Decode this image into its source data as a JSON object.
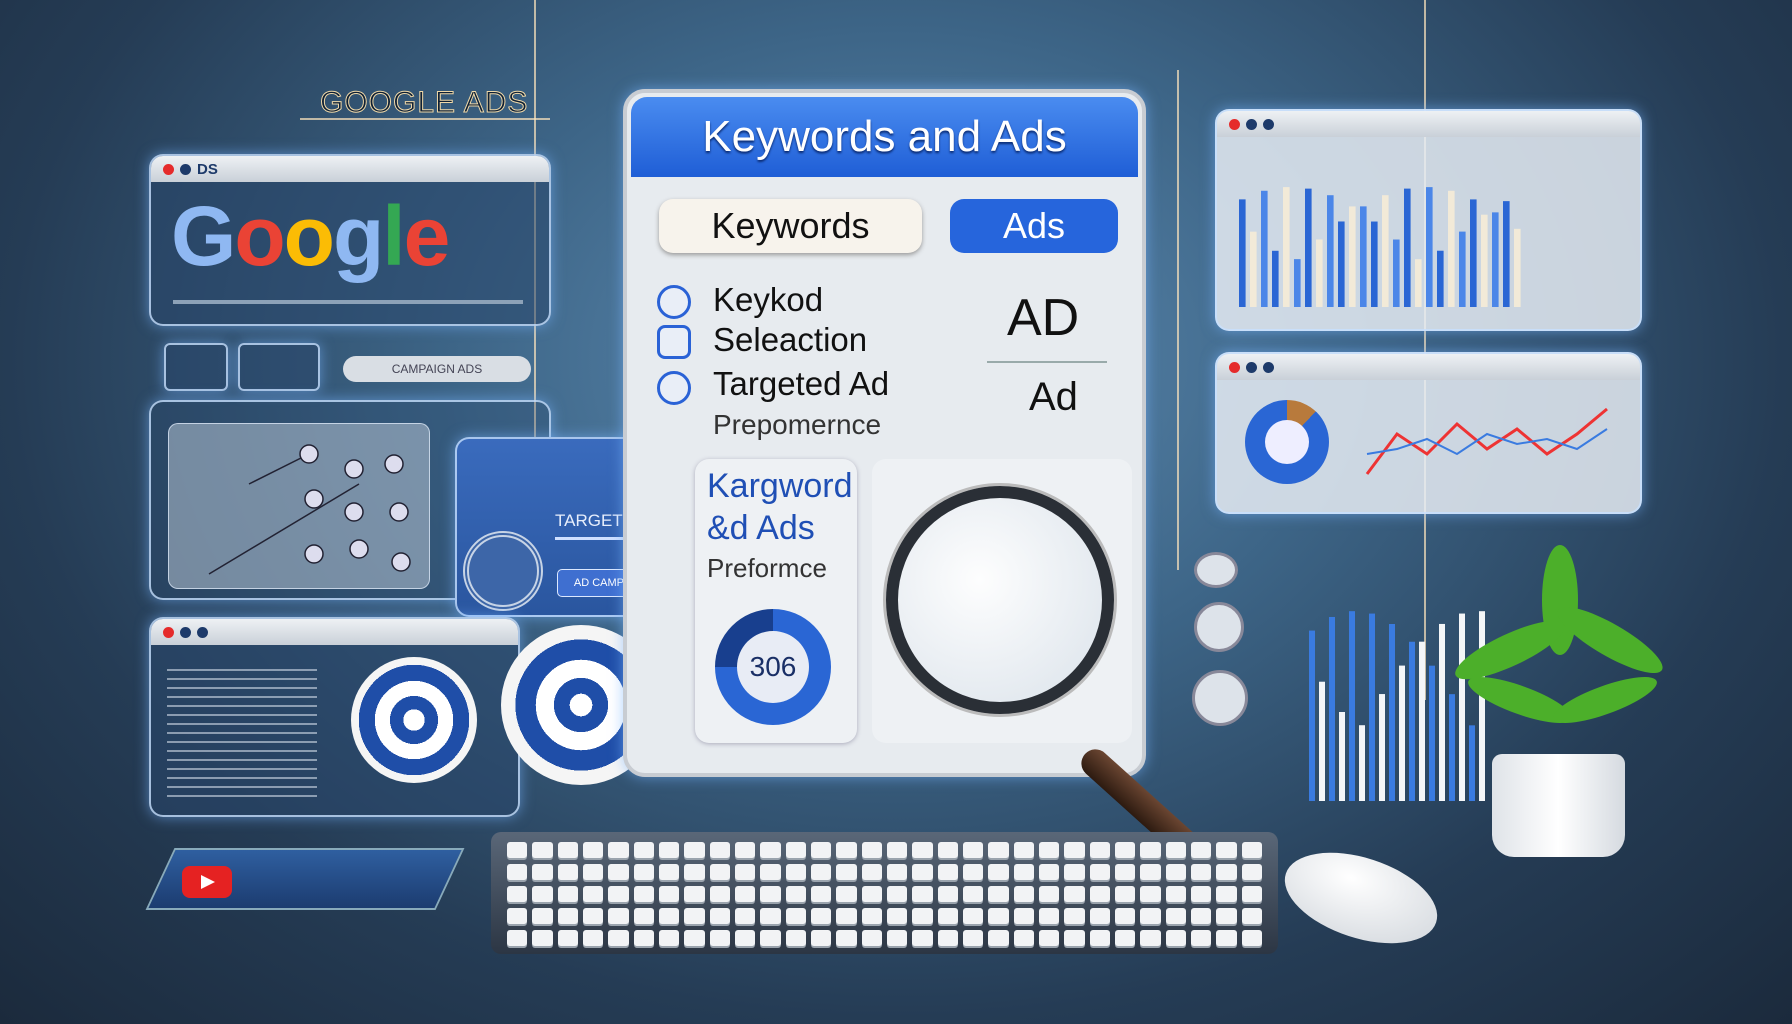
{
  "brand_title": "GOOGLE ADS",
  "left_window": {
    "tab_label": "DS",
    "logo": "Google",
    "button_label": "CAMPAIGN ADS"
  },
  "targeted_card": {
    "title": "TARGETED",
    "button_label": "AD CAMPAIGN"
  },
  "center_panel": {
    "title": "Keywords and Ads",
    "tabs": [
      {
        "label": "Keywords",
        "active": false
      },
      {
        "label": "Ads",
        "active": true
      }
    ],
    "list": [
      "Keykod",
      "Seleaction",
      "Targeted Ad",
      "Prepomernce"
    ],
    "ad_big": "AD",
    "ad_small": "Ad",
    "card_title_lines": [
      "Kargword",
      "&d Ads",
      "Preformce"
    ],
    "gauge_value": "306",
    "gauge_fraction": 0.75
  },
  "colors": {
    "accent": "#2a62d6",
    "header_blue": "#2f6fe0",
    "background": "#2e4b6a",
    "google_blue": "#4285f4",
    "google_red": "#ea4335",
    "google_yellow": "#fbbc05",
    "google_green": "#34a853"
  },
  "icons": [
    "target-icon",
    "magnifier-icon",
    "plant-icon",
    "keyboard-icon",
    "mouse-icon",
    "youtube-icon",
    "donut-chart-icon",
    "bar-chart-icon",
    "line-chart-icon"
  ]
}
